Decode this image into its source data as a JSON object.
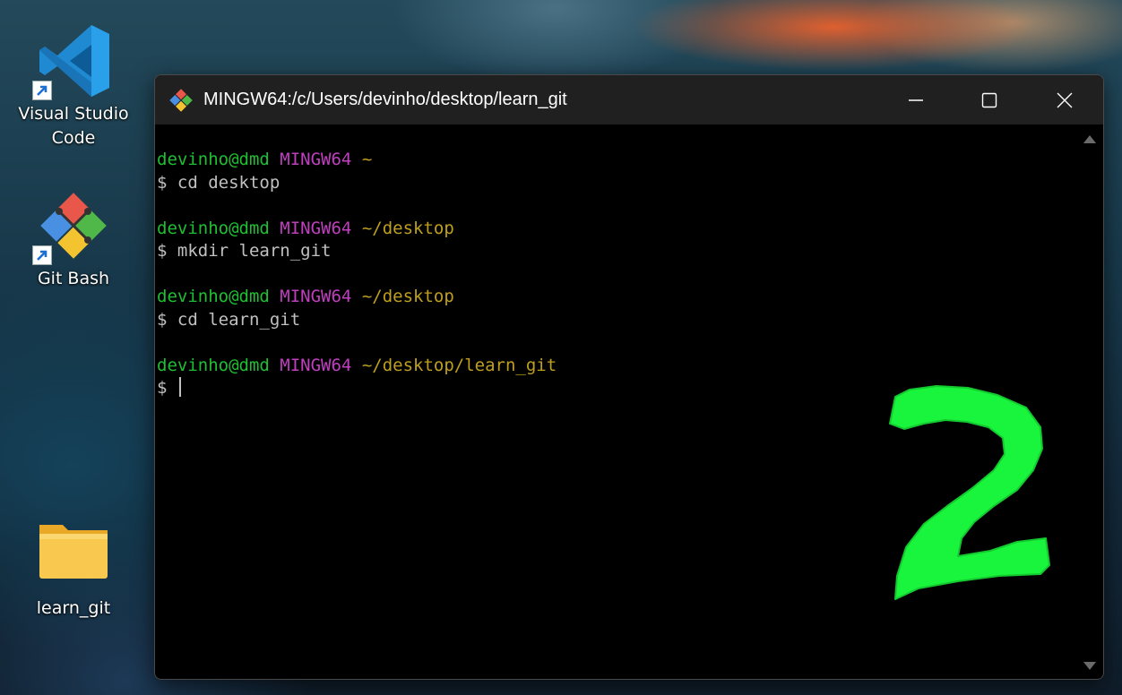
{
  "desktop": {
    "icons": [
      {
        "label": "Visual Studio\nCode",
        "icon": "vscode-icon"
      },
      {
        "label": "Git Bash",
        "icon": "git-bash-icon"
      },
      {
        "label": "learn_git",
        "icon": "folder-icon"
      }
    ]
  },
  "window": {
    "title": "MINGW64:/c/Users/devinho/desktop/learn_git",
    "controls": {
      "minimize": "minimize",
      "maximize": "maximize",
      "close": "close"
    }
  },
  "terminal": {
    "blocks": [
      {
        "user": "devinho@dmd",
        "host": "MINGW64",
        "path": "~",
        "command": "$ cd desktop"
      },
      {
        "user": "devinho@dmd",
        "host": "MINGW64",
        "path": "~/desktop",
        "command": "$ mkdir learn_git"
      },
      {
        "user": "devinho@dmd",
        "host": "MINGW64",
        "path": "~/desktop",
        "command": "$ cd learn_git"
      },
      {
        "user": "devinho@dmd",
        "host": "MINGW64",
        "path": "~/desktop/learn_git",
        "command": "$ "
      }
    ]
  },
  "annotation": {
    "text": "2",
    "color": "#19f53c"
  },
  "colors": {
    "user": "#1fbf33",
    "host": "#bf3fbf",
    "path": "#bf9f1f",
    "text": "#c0c0c0",
    "titlebar": "#202020"
  }
}
